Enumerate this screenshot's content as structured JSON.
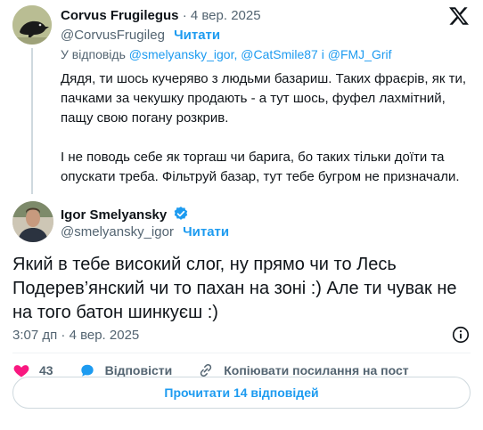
{
  "parent_tweet": {
    "author_name": "Corvus Frugilegus",
    "date": "· 4 вер. 2025",
    "handle": "@CorvusFrugileg",
    "follow_label": "Читати",
    "reply_to_prefix": "У відповідь",
    "reply_to_mentions": "@smelyansky_igor, @CatSmile87 і @FMJ_Grif",
    "body_paragraphs": [
      "Дядя, ти шось кучеряво з людьми базариш. Таких фраєрів, як ти, пачками за чекушку продають - а тут шось, фуфел лахмітний, пащу свою погану розкрив.",
      "І не поводь себе як торгаш чи барига, бо таких тільки доїти та опускати треба. Фільтруй базар, тут тебе бугром не призначали."
    ],
    "avatar_icon": "crow-avatar"
  },
  "main_tweet": {
    "author_name": "Igor Smelyansky",
    "handle": "@smelyansky_igor",
    "follow_label": "Читати",
    "verified_icon": "verified-badge-icon",
    "body": "Який в тебе високий слог, ну прямо чи то Лесь Подерев’янский чи то пахан на зоні :) Але ти чувак не на того батон шинкуєш :)",
    "timestamp": "3:07 дп · 4 вер. 2025"
  },
  "actions": {
    "likes_count": "43",
    "reply_label": "Відповісти",
    "copy_link_label": "Копіювати посилання на пост"
  },
  "read_replies_label": "Прочитати 14 відповідей",
  "colors": {
    "accent": "#1d9bf0",
    "like": "#f91880",
    "text": "#0f1419",
    "muted": "#536471"
  }
}
